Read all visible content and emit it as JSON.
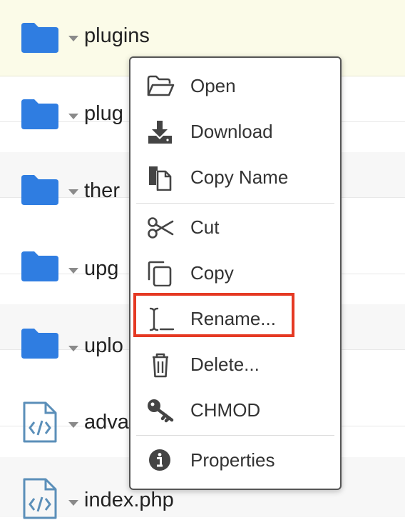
{
  "colors": {
    "folder": "#2f7de1",
    "code_file": "#5b8fb9",
    "highlight": "#e53923",
    "selected_row": "#fbfbe8"
  },
  "file_list": {
    "rows": [
      {
        "name": "plugins",
        "icon": "folder-icon"
      },
      {
        "name": "plug",
        "icon": "folder-icon"
      },
      {
        "name": "ther",
        "icon": "folder-icon"
      },
      {
        "name": "upg",
        "icon": "folder-icon"
      },
      {
        "name": "uplo",
        "icon": "folder-icon"
      },
      {
        "name": "adva",
        "icon": "code-file-icon"
      },
      {
        "name": "index.php",
        "icon": "code-file-icon"
      }
    ]
  },
  "context_menu": {
    "items": [
      {
        "label": "Open",
        "icon": "folder-open-icon"
      },
      {
        "label": "Download",
        "icon": "download-icon"
      },
      {
        "label": "Copy Name",
        "icon": "copy-name-icon"
      },
      {
        "label": "Cut",
        "icon": "scissors-icon"
      },
      {
        "label": "Copy",
        "icon": "copy-icon"
      },
      {
        "label": "Rename...",
        "icon": "text-cursor-icon"
      },
      {
        "label": "Delete...",
        "icon": "trash-icon"
      },
      {
        "label": "CHMOD",
        "icon": "key-icon"
      },
      {
        "label": "Properties",
        "icon": "info-icon"
      }
    ]
  }
}
